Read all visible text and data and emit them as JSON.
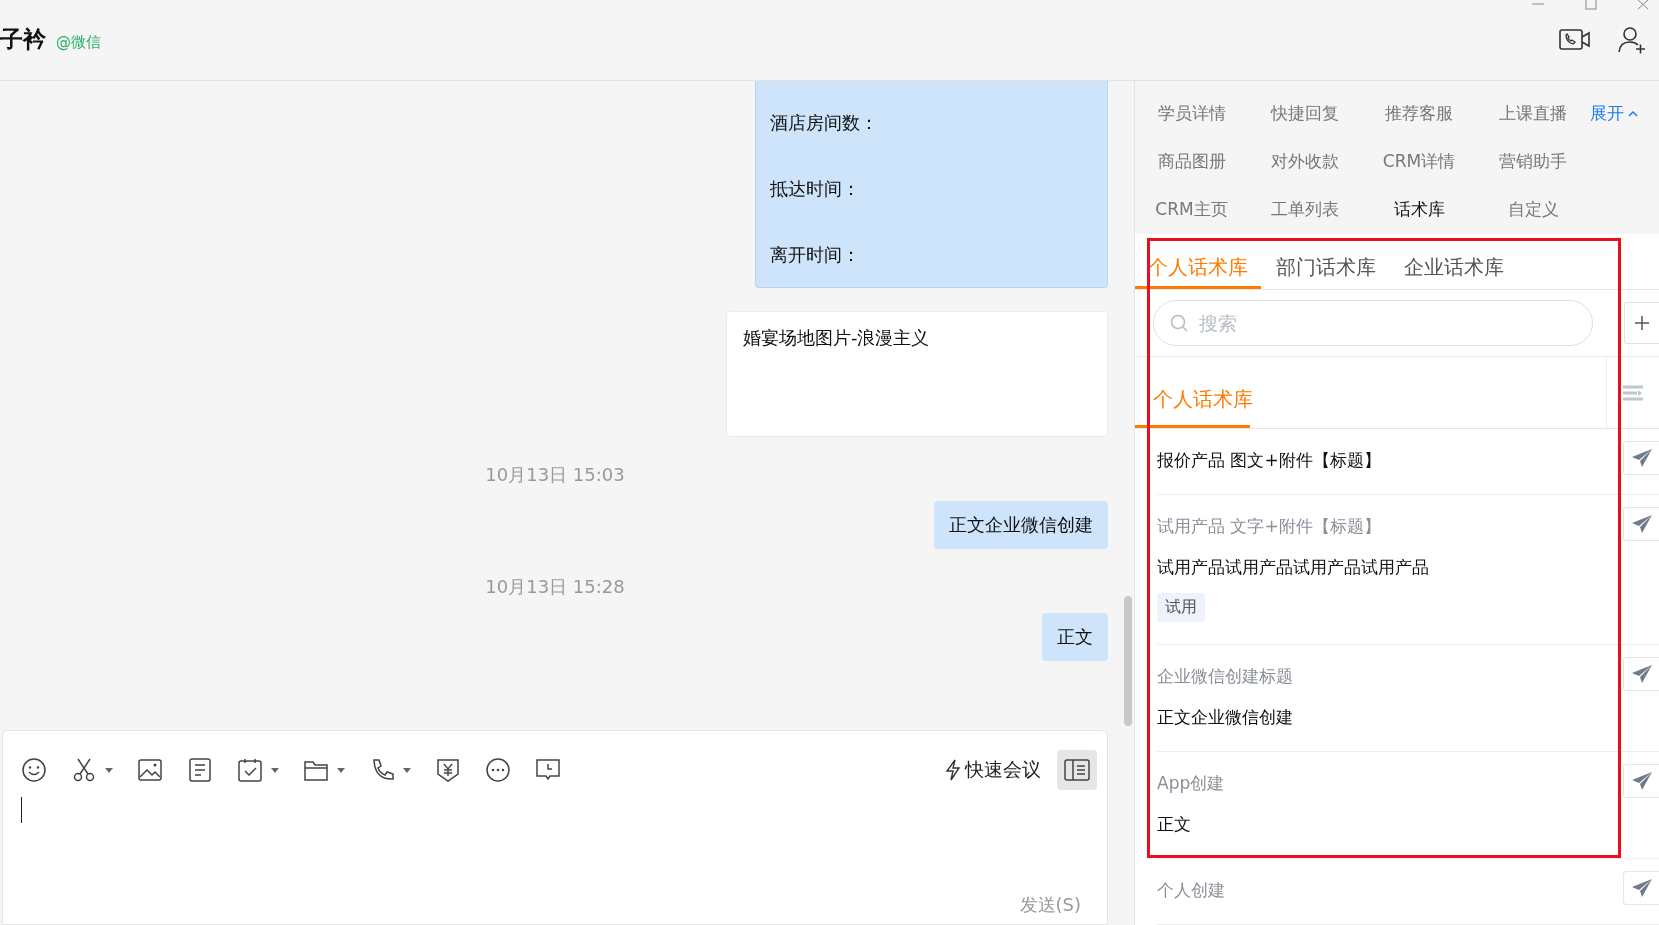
{
  "window": {
    "title": "子衿",
    "source": "@微信"
  },
  "messages": [
    {
      "kind": "form",
      "lines": [
        "酒店房间数：",
        "抵达时间：",
        "离开时间："
      ]
    },
    {
      "kind": "card",
      "text": "婚宴场地图片-浪漫主义"
    },
    {
      "kind": "time",
      "text": "10月13日 15:03"
    },
    {
      "kind": "bubble",
      "text": "正文企业微信创建"
    },
    {
      "kind": "time",
      "text": "10月13日 15:28"
    },
    {
      "kind": "bubble",
      "text": "正文"
    }
  ],
  "composer": {
    "quick_meeting": "快速会议",
    "send": "发送(S)"
  },
  "tool_tabs": [
    {
      "label": "学员详情",
      "selected": false
    },
    {
      "label": "快捷回复",
      "selected": false
    },
    {
      "label": "推荐客服",
      "selected": false
    },
    {
      "label": "上课直播",
      "selected": false
    },
    {
      "label": "商品图册",
      "selected": false
    },
    {
      "label": "对外收款",
      "selected": false
    },
    {
      "label": "CRM详情",
      "selected": false
    },
    {
      "label": "营销助手",
      "selected": false
    },
    {
      "label": "CRM主页",
      "selected": false
    },
    {
      "label": "工单列表",
      "selected": false
    },
    {
      "label": "话术库",
      "selected": true
    },
    {
      "label": "自定义",
      "selected": false
    }
  ],
  "expand": "展开",
  "library_tabs": [
    {
      "label": "个人话术库",
      "selected": true
    },
    {
      "label": "部门话术库",
      "selected": false
    },
    {
      "label": "企业话术库",
      "selected": false
    }
  ],
  "search": {
    "placeholder": "搜索"
  },
  "section": {
    "label": "个人话术库",
    "selected": true
  },
  "scripts": [
    {
      "kind": "heading",
      "title": "报价产品 图文+附件【标题】"
    },
    {
      "kind": "message",
      "title": "试用产品 文字+附件【标题】",
      "body": "试用产品试用产品试用产品试用产品",
      "tag": "试用"
    },
    {
      "kind": "message",
      "title": "企业微信创建标题",
      "body": "正文企业微信创建"
    },
    {
      "kind": "message",
      "title": "App创建",
      "body": "正文"
    },
    {
      "kind": "message",
      "title": "个人创建"
    }
  ]
}
